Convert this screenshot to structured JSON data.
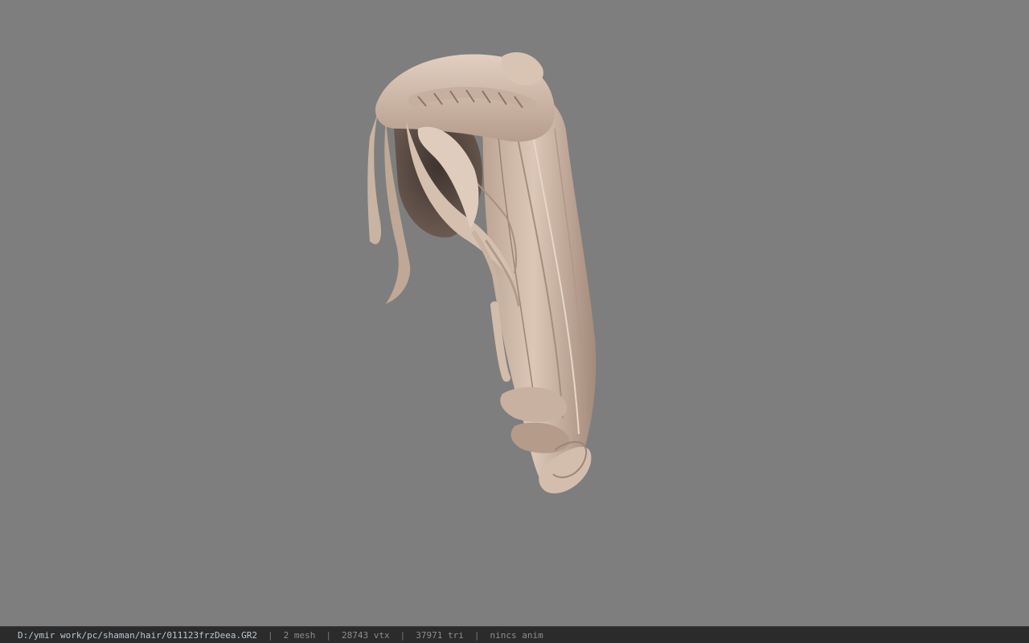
{
  "status_bar": {
    "file_path": "D:/ymir work/pc/shaman/hair/011123frzDeea.GR2",
    "separator": "|",
    "mesh_count": "2 mesh",
    "vertex_count": "28743 vtx",
    "triangle_count": "37971 tri",
    "anim_status": "nincs anim"
  },
  "viewport": {
    "background_color": "#7e7e7e",
    "model": "hair-model"
  },
  "colors": {
    "hair_light": "#d8c2b2",
    "hair_mid": "#b9a08f",
    "hair_dark": "#5a4a42",
    "status_bg": "#2b2b2b"
  }
}
